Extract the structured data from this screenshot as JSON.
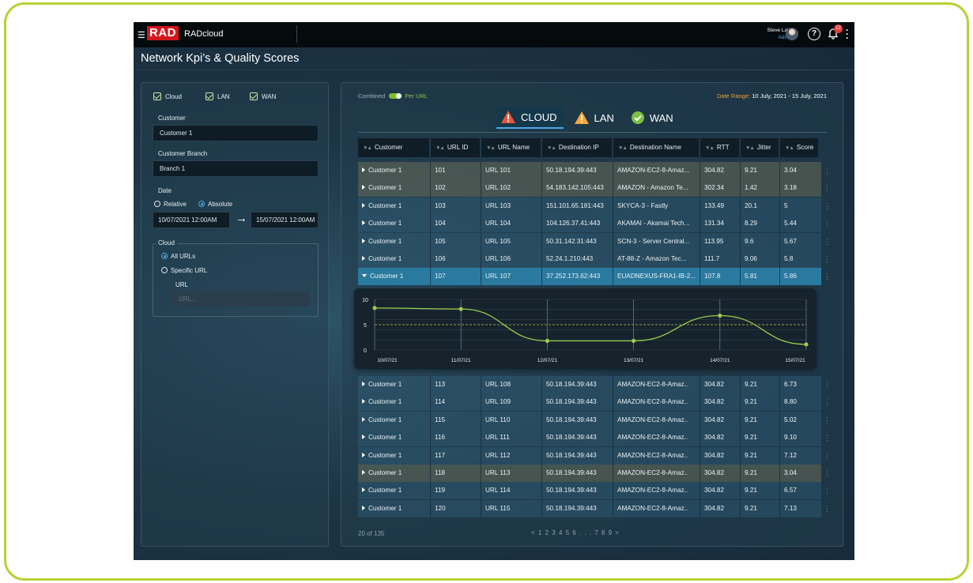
{
  "app": {
    "name": "RADcloud",
    "logo": "RAD",
    "user_name": "Steve Lake",
    "user_role": "Admin",
    "notification_count": "12",
    "page_title": "Network Kpi’s & Quality Scores"
  },
  "filters": {
    "checkboxes": [
      {
        "label": "Cloud",
        "checked": true
      },
      {
        "label": "LAN",
        "checked": true
      },
      {
        "label": "WAN",
        "checked": true
      }
    ],
    "customer_label": "Customer",
    "customer_value": "Customer 1",
    "branch_label": "Customer Branch",
    "branch_value": "Branch 1",
    "date_label": "Date",
    "date_relative": "Relative",
    "date_absolute": "Absolute",
    "date_from": "10/07/2021  12:00AM",
    "date_to": "15/07/2021  12:00AM",
    "cloud_legend": "Cloud",
    "all_urls": "All URLs",
    "specific_url": "Specific URL",
    "url_label": "URL",
    "url_placeholder": "URL..."
  },
  "panel": {
    "combined": "Combined",
    "per_url": "Per URL",
    "date_range_label": "Date Range:",
    "date_range_value": "10 July, 2021 - 15 July, 2021",
    "tabs": [
      {
        "label": "CLOUD",
        "icon": "warning-icon",
        "color": "#e8553a",
        "active": true
      },
      {
        "label": "LAN",
        "icon": "warning-icon",
        "color": "#f2a93b",
        "active": false
      },
      {
        "label": "WAN",
        "icon": "check-icon",
        "color": "#7bc043",
        "active": false
      }
    ],
    "colors": {
      "highlight": "#6e6a52",
      "selected": "#2a7aa0",
      "accent": "#8cc63f"
    }
  },
  "table": {
    "columns": [
      "Customer",
      "URL ID",
      "URL Name",
      "Destination IP",
      "Destination Name",
      "RTT",
      "Jitter",
      "Score"
    ],
    "rows_top": [
      {
        "customer": "Customer 1",
        "id": "101",
        "name": "URL 101",
        "ip": "50.18.194.39:443",
        "dest": "AMAZON-EC2-8-Amaz...",
        "rtt": "304.82",
        "jitter": "9.21",
        "score": "3.04",
        "style": "hl"
      },
      {
        "customer": "Customer 1",
        "id": "102",
        "name": "URL 102",
        "ip": "54.183.142.105:443",
        "dest": "AMAZON - Amazon Te...",
        "rtt": "302.34",
        "jitter": "1.42",
        "score": "3.18",
        "style": "hl"
      },
      {
        "customer": "Customer 1",
        "id": "103",
        "name": "URL 103",
        "ip": "151.101.65.181:443",
        "dest": "SKYCA-3 - Fastly",
        "rtt": "133.49",
        "jitter": "20.1",
        "score": "5",
        "style": "norm"
      },
      {
        "customer": "Customer 1",
        "id": "104",
        "name": "URL 104",
        "ip": "104.126.37.41:443",
        "dest": "AKAMAI - Akamai Tech...",
        "rtt": "131.34",
        "jitter": "8.29",
        "score": "5.44",
        "style": "norm"
      },
      {
        "customer": "Customer 1",
        "id": "105",
        "name": "URL 105",
        "ip": "50.31.142.31:443",
        "dest": "SCN-3 - Server Central...",
        "rtt": "113.95",
        "jitter": "9.6",
        "score": "5.67",
        "style": "norm"
      },
      {
        "customer": "Customer 1",
        "id": "106",
        "name": "URL 106",
        "ip": "52.24.1.210:443",
        "dest": "AT-88-Z - Amazon Tec...",
        "rtt": "111.7",
        "jitter": "9.06",
        "score": "5.8",
        "style": "norm"
      },
      {
        "customer": "Customer 1",
        "id": "107",
        "name": "URL 107",
        "ip": "37.252.173.62:443",
        "dest": "EUADNEXUS-FRA1-IB-2...",
        "rtt": "107.8",
        "jitter": "5.81",
        "score": "5.86",
        "style": "sel"
      }
    ],
    "rows_bottom": [
      {
        "customer": "Customer 1",
        "id": "113",
        "name": "URL 108",
        "ip": "50.18.194.39:443",
        "dest": "AMAZON-EC2-8-Amaz..",
        "rtt": "304.82",
        "jitter": "9.21",
        "score": "6.73",
        "style": "norm"
      },
      {
        "customer": "Customer 1",
        "id": "114",
        "name": "URL 109",
        "ip": "50.18.194.39:443",
        "dest": "AMAZON-EC2-8-Amaz..",
        "rtt": "304.82",
        "jitter": "9.21",
        "score": "8.80",
        "style": "norm"
      },
      {
        "customer": "Customer 1",
        "id": "115",
        "name": "URL 110",
        "ip": "50.18.194.39:443",
        "dest": "AMAZON-EC2-8-Amaz..",
        "rtt": "304.82",
        "jitter": "9.21",
        "score": "5.02",
        "style": "norm"
      },
      {
        "customer": "Customer 1",
        "id": "116",
        "name": "URL 111",
        "ip": "50.18.194.39:443",
        "dest": "AMAZON-EC2-8-Amaz..",
        "rtt": "304.82",
        "jitter": "9.21",
        "score": "9.10",
        "style": "norm"
      },
      {
        "customer": "Customer 1",
        "id": "117",
        "name": "URL 112",
        "ip": "50.18.194.39:443",
        "dest": "AMAZON-EC2-8-Amaz..",
        "rtt": "304.82",
        "jitter": "9.21",
        "score": "7.12",
        "style": "norm"
      },
      {
        "customer": "Customer 1",
        "id": "118",
        "name": "URL 113",
        "ip": "50.18.194.39:443",
        "dest": "AMAZON-EC2-8-Amaz..",
        "rtt": "304.82",
        "jitter": "9.21",
        "score": "3.04",
        "style": "hl"
      },
      {
        "customer": "Customer 1",
        "id": "119",
        "name": "URL 114",
        "ip": "50.18.194.39:443",
        "dest": "AMAZON-EC2-8-Amaz..",
        "rtt": "304.82",
        "jitter": "9.21",
        "score": "6.57",
        "style": "norm"
      },
      {
        "customer": "Customer 1",
        "id": "120",
        "name": "URL 115",
        "ip": "50.18.194.39:443",
        "dest": "AMAZON-EC2-8-Amaz..",
        "rtt": "304.82",
        "jitter": "9.21",
        "score": "7.13",
        "style": "norm"
      }
    ],
    "count": "20 of 135",
    "pagination": "< 1 2 3 4 5 6 . . . 7 8 9 >"
  },
  "chart_data": {
    "type": "line",
    "x": [
      "10/07/21",
      "11/07/21",
      "12/07/21",
      "13/07/21",
      "14/07/21",
      "15/07/21"
    ],
    "values": [
      8.3,
      8.1,
      1.8,
      1.8,
      6.8,
      1.1
    ],
    "ylim": [
      0,
      10
    ],
    "yticks": [
      0,
      5,
      10
    ],
    "threshold": 5,
    "grid": true
  }
}
